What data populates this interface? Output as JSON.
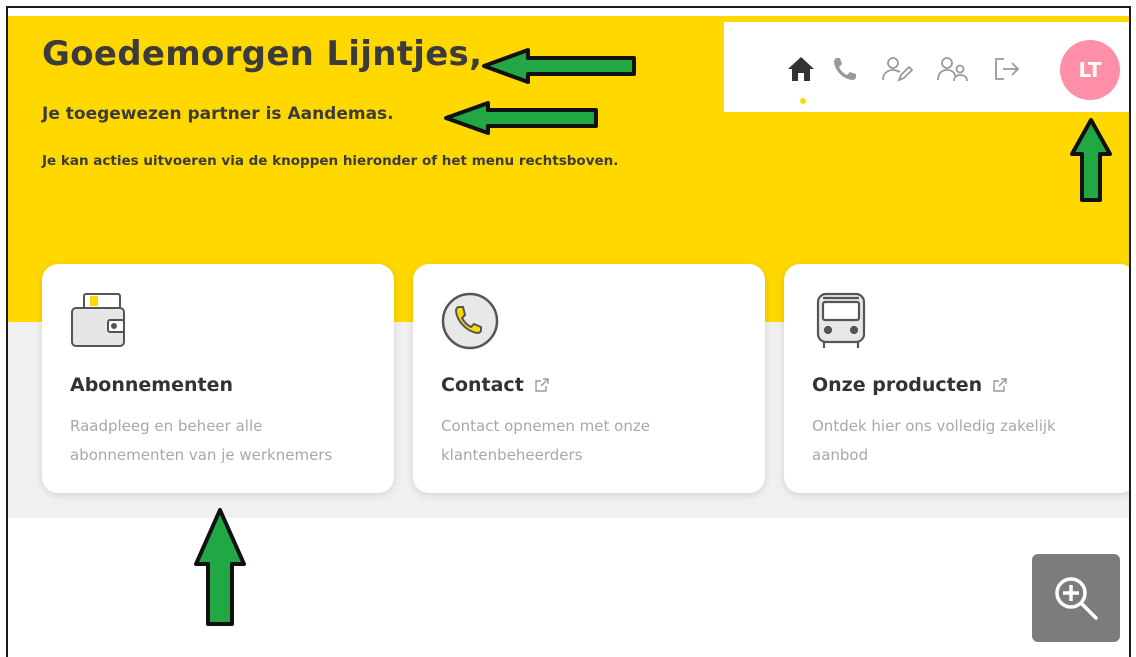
{
  "header": {
    "greeting": "Goedemorgen Lijntjes,",
    "partner": "Je toegewezen partner is Aandemas.",
    "hint": "Je kan acties uitvoeren via de knoppen hieronder of het menu rechtsboven."
  },
  "nav": {
    "active_icon": "home-icon",
    "icons": [
      "home-icon",
      "phone-icon",
      "user-edit-icon",
      "users-icon",
      "logout-icon"
    ],
    "avatar_initials": "LT",
    "accent_color": "#ffd800",
    "avatar_color": "#ff8fa8"
  },
  "cards": [
    {
      "icon": "wallet-icon",
      "title": "Abonnementen",
      "description": "Raadpleeg en beheer alle abonnementen van je werknemers",
      "external": false
    },
    {
      "icon": "phone-circle-icon",
      "title": "Contact",
      "description": "Contact opnemen met onze klantenbeheerders",
      "external": true
    },
    {
      "icon": "bus-icon",
      "title": "Onze producten",
      "description": "Ontdek hier ons volledig zakelijk aanbod",
      "external": true
    }
  ],
  "zoom": {
    "icon": "zoom-in-icon"
  },
  "annotation_color": "#22a745"
}
